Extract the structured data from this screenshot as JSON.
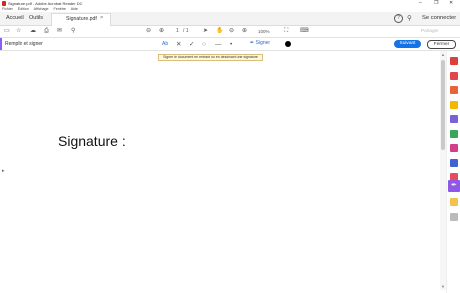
{
  "window": {
    "title": "Signature.pdf - Adobe Acrobat Reader DC",
    "minimize": "–",
    "restore": "❐",
    "close": "✕"
  },
  "menu": [
    "Fichier",
    "Édition",
    "Affichage",
    "Fenêtre",
    "Aide"
  ],
  "tabs": {
    "home": "Accueil",
    "tools": "Outils",
    "doc": "Signature.pdf",
    "doc_close": "×"
  },
  "account": {
    "help": "?",
    "bell": "🔔",
    "connect": "Se connecter"
  },
  "toolbar": {
    "page_current": "1",
    "page_total": "/ 1",
    "zoom": "100%",
    "share": "Partager"
  },
  "fillsign": {
    "title": "Remplir et signer",
    "text_tool": "Ab",
    "cross": "✕",
    "check": "✓",
    "circle": "○",
    "line": "—",
    "dot": "•",
    "sign": "Signer",
    "next": "Suivant",
    "close": "Fermer"
  },
  "tooltip": "Signer le document en entrant ou en dessinant une signature",
  "document": {
    "text": "Signature :"
  },
  "colors": {
    "accent": "#1473e6",
    "fillsign": "#8e59e6",
    "pdf_red": "#d9261c"
  }
}
